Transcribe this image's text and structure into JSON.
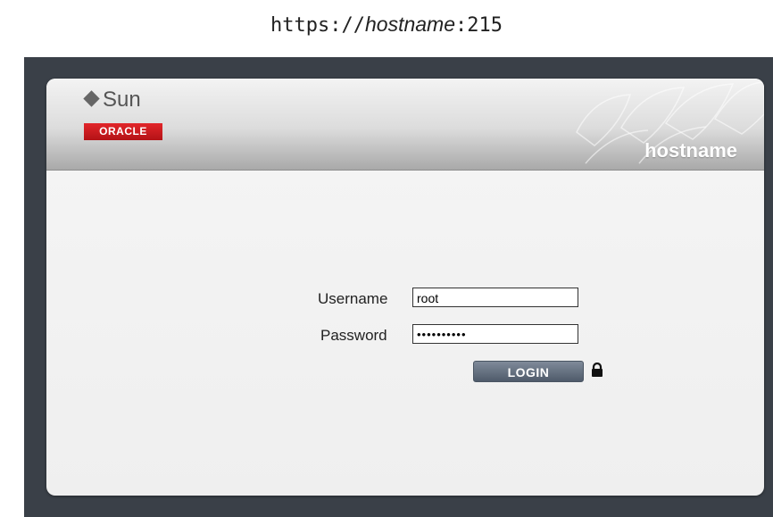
{
  "caption": {
    "prefix": "https://",
    "host": "hostname",
    "suffix": ":215"
  },
  "header": {
    "logo_sun": "Sun",
    "logo_oracle": "ORACLE",
    "hostname": "hostname"
  },
  "login": {
    "username_label": "Username",
    "username_value": "root",
    "password_label": "Password",
    "password_masked": "••••••••••",
    "button_label": "LOGIN"
  },
  "icons": {
    "lock": "lock-icon"
  },
  "colors": {
    "oracle_red": "#d01f24",
    "frame_dark": "#3a4048",
    "button": "#5f6b7b"
  }
}
